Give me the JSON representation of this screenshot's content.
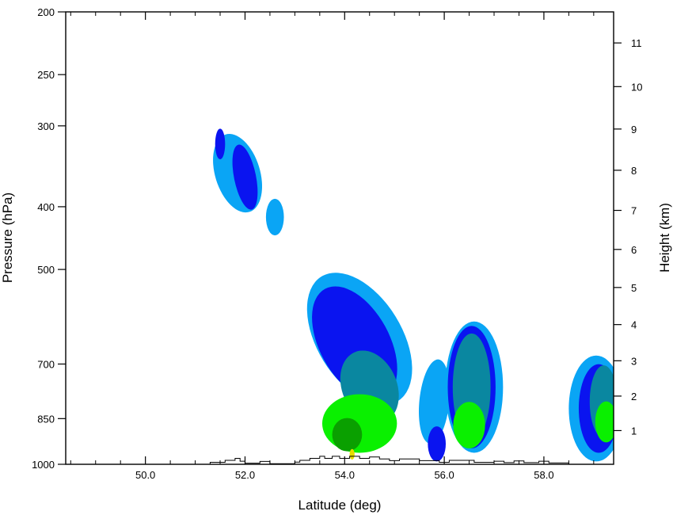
{
  "chart_data": {
    "type": "heatmap",
    "xlabel": "Latitude (deg)",
    "ylabel": "Pressure (hPa)",
    "y2label": "Height (km)",
    "xlim": [
      48.4,
      59.4
    ],
    "ylim": [
      1000,
      200
    ],
    "y_scale": "log",
    "x_tick_labels": [
      "50.0",
      "52.0",
      "54.0",
      "56.0",
      "58.0"
    ],
    "x_ticks": [
      50,
      52,
      54,
      56,
      58
    ],
    "x_minor_ticks": [
      48.5,
      49,
      49.5,
      50.5,
      51,
      51.5,
      52.5,
      53,
      53.5,
      54.5,
      55,
      55.5,
      56.5,
      57,
      57.5,
      58.5,
      59
    ],
    "y_tick_labels": [
      "200",
      "250",
      "300",
      "400",
      "500",
      "700",
      "850",
      "1000"
    ],
    "y_ticks": [
      200,
      250,
      300,
      400,
      500,
      700,
      850,
      1000
    ],
    "y2_tick_labels": [
      "1",
      "2",
      "3",
      "4",
      "5",
      "6",
      "7",
      "8",
      "9",
      "10",
      "11"
    ],
    "y2_ticks": [
      1,
      2,
      3,
      4,
      5,
      6,
      7,
      8,
      9,
      10,
      11
    ],
    "grid": false,
    "legend": "none",
    "level_colors": [
      "#0aa5f5",
      "#0a14f0",
      "#0a87a0",
      "#0af000",
      "#0aa000",
      "#e6dc00"
    ],
    "terrain": {
      "latitude": [
        48.4,
        51.3,
        51.3,
        51.6,
        51.6,
        51.8,
        51.8,
        51.9,
        51.9,
        52.0,
        52.0,
        52.3,
        52.3,
        52.5,
        52.5,
        53.0,
        53.0,
        53.1,
        53.1,
        53.3,
        53.3,
        53.5,
        53.5,
        53.6,
        53.6,
        53.75,
        53.75,
        53.9,
        53.9,
        54.1,
        54.1,
        54.3,
        54.3,
        54.5,
        54.5,
        54.7,
        54.7,
        54.9,
        54.9,
        55.1,
        55.1,
        55.5,
        55.5,
        55.9,
        55.9,
        56.1,
        56.1,
        56.6,
        56.6,
        57.0,
        57.0,
        57.2,
        57.2,
        57.4,
        57.4,
        57.6,
        57.6,
        57.9,
        57.9,
        58.1,
        58.1,
        58.5,
        58.5,
        59.4
      ],
      "pressure": [
        1000,
        1000,
        993,
        993,
        986,
        986,
        979,
        979,
        989,
        989,
        996,
        996,
        990,
        990,
        998,
        998,
        992,
        992,
        986,
        986,
        979,
        979,
        972,
        972,
        979,
        979,
        972,
        972,
        979,
        979,
        972,
        972,
        979,
        979,
        974,
        974,
        981,
        981,
        987,
        987,
        981,
        981,
        987,
        987,
        993,
        993,
        986,
        986,
        993,
        993,
        989,
        989,
        994,
        994,
        988,
        988,
        994,
        994,
        989,
        989,
        995,
        995,
        1000,
        1000
      ]
    },
    "blobs": [
      {
        "level": 0,
        "lat": 51.85,
        "p": 355,
        "rx": 0.45,
        "rp": 55,
        "rot": -0.3
      },
      {
        "level": 0,
        "lat": 52.6,
        "p": 415,
        "rx": 0.18,
        "rp": 28,
        "rot": 0.0
      },
      {
        "level": 1,
        "lat": 52.0,
        "p": 360,
        "rx": 0.22,
        "rp": 45,
        "rot": -0.2
      },
      {
        "level": 1,
        "lat": 51.5,
        "p": 320,
        "rx": 0.1,
        "rp": 18,
        "rot": 0.0
      },
      {
        "level": 0,
        "lat": 54.3,
        "p": 640,
        "rx": 0.85,
        "rp": 190,
        "rot": -0.55
      },
      {
        "level": 1,
        "lat": 54.2,
        "p": 650,
        "rx": 0.7,
        "rp": 160,
        "rot": -0.5
      },
      {
        "level": 2,
        "lat": 54.5,
        "p": 760,
        "rx": 0.55,
        "rp": 110,
        "rot": -0.4
      },
      {
        "level": 3,
        "lat": 54.3,
        "p": 865,
        "rx": 0.75,
        "rp": 95,
        "rot": 0.0
      },
      {
        "level": 4,
        "lat": 54.05,
        "p": 900,
        "rx": 0.3,
        "rp": 55,
        "rot": 0.0
      },
      {
        "level": 5,
        "lat": 54.15,
        "p": 965,
        "rx": 0.05,
        "rp": 18,
        "rot": 0.0
      },
      {
        "level": 0,
        "lat": 55.8,
        "p": 800,
        "rx": 0.3,
        "rp": 130,
        "rot": 0.1
      },
      {
        "level": 1,
        "lat": 55.85,
        "p": 930,
        "rx": 0.18,
        "rp": 60,
        "rot": 0.0
      },
      {
        "level": 0,
        "lat": 56.6,
        "p": 760,
        "rx": 0.58,
        "rp": 200,
        "rot": 0.0
      },
      {
        "level": 1,
        "lat": 56.55,
        "p": 760,
        "rx": 0.48,
        "rp": 185,
        "rot": 0.0
      },
      {
        "level": 2,
        "lat": 56.55,
        "p": 760,
        "rx": 0.38,
        "rp": 160,
        "rot": 0.0
      },
      {
        "level": 3,
        "lat": 56.5,
        "p": 870,
        "rx": 0.32,
        "rp": 75,
        "rot": 0.0
      },
      {
        "level": 0,
        "lat": 59.05,
        "p": 820,
        "rx": 0.55,
        "rp": 170,
        "rot": 0.0
      },
      {
        "level": 1,
        "lat": 59.1,
        "p": 820,
        "rx": 0.4,
        "rp": 140,
        "rot": 0.0
      },
      {
        "level": 2,
        "lat": 59.2,
        "p": 800,
        "rx": 0.28,
        "rp": 110,
        "rot": 0.0
      },
      {
        "level": 3,
        "lat": 59.25,
        "p": 860,
        "rx": 0.22,
        "rp": 65,
        "rot": 0.0
      }
    ]
  }
}
